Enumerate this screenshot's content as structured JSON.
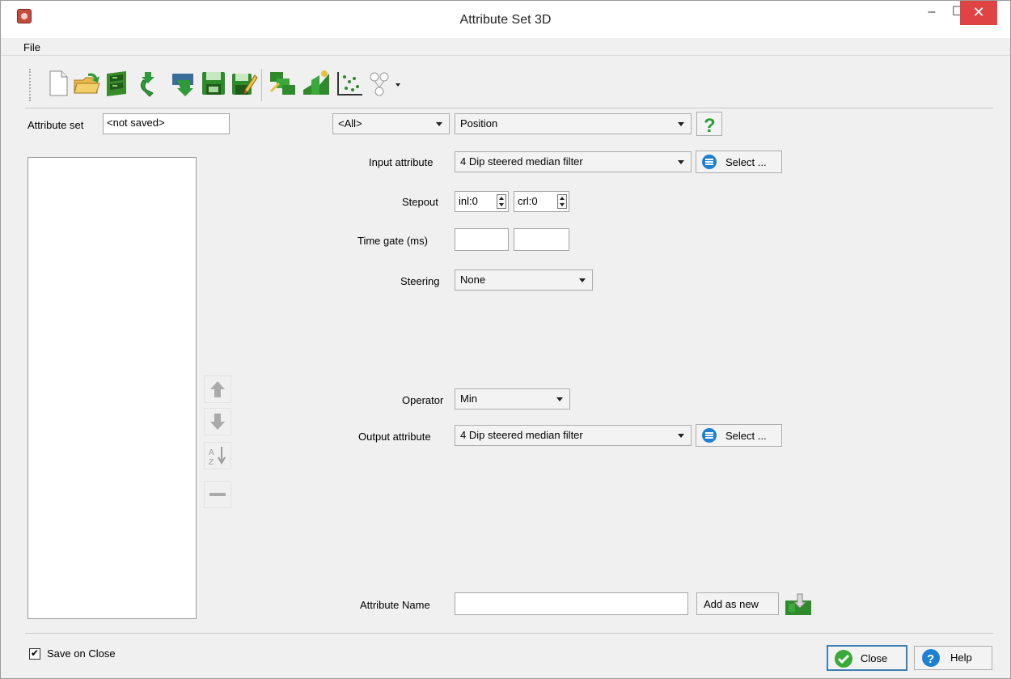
{
  "window": {
    "title": "Attribute Set 3D",
    "controls": {
      "minimize": "–",
      "maximize": "☐",
      "close": "✕"
    }
  },
  "menu": {
    "file": "File"
  },
  "toolbar": {
    "icons": [
      "new-file-icon",
      "open-folder-icon",
      "database-icon",
      "import-icon",
      "reimport-icon",
      "save-icon",
      "save-as-icon",
      "evaluate-icon",
      "crossplot-icon",
      "cross-plot-attributes-icon",
      "neural-network-icon"
    ]
  },
  "attribute_set": {
    "label": "Attribute set",
    "value": "<not saved>"
  },
  "filters": {
    "group": "<All>",
    "attribute_type": "Position"
  },
  "form": {
    "input_attribute": {
      "label": "Input attribute",
      "value": "4 Dip steered median filter",
      "select_button": "Select ..."
    },
    "stepout": {
      "label": "Stepout",
      "inl": "inl:0",
      "crl": "crl:0"
    },
    "time_gate": {
      "label": "Time gate (ms)",
      "start": "",
      "end": ""
    },
    "steering": {
      "label": "Steering",
      "value": "None"
    },
    "operator": {
      "label": "Operator",
      "value": "Min"
    },
    "output_attribute": {
      "label": "Output attribute",
      "value": "4 Dip steered median filter",
      "select_button": "Select ..."
    },
    "attribute_name": {
      "label": "Attribute Name",
      "value": "",
      "add_button": "Add as new"
    }
  },
  "footer": {
    "save_on_close": {
      "label": "Save on Close",
      "checked": true,
      "mark": "✔"
    },
    "close_button": "Close",
    "help_button": "Help"
  },
  "colors": {
    "close_red": "#e04343",
    "accent_green": "#2e9a3a",
    "accent_blue": "#1f7fd1"
  }
}
